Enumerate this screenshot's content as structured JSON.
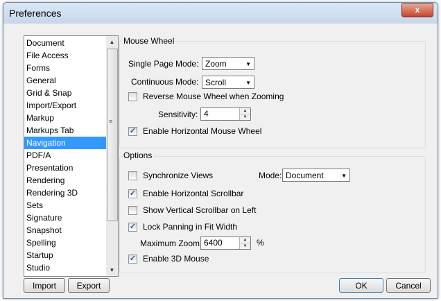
{
  "window": {
    "title": "Preferences",
    "close_glyph": "x"
  },
  "categories": {
    "items": [
      "Document",
      "File Access",
      "Forms",
      "General",
      "Grid & Snap",
      "Import/Export",
      "Markup",
      "Markups Tab",
      "Navigation",
      "PDF/A",
      "Presentation",
      "Rendering",
      "Rendering 3D",
      "Sets",
      "Signature",
      "Snapshot",
      "Spelling",
      "Startup",
      "Studio"
    ],
    "selected": "Navigation"
  },
  "mouse_wheel": {
    "group_label": "Mouse Wheel",
    "single_page_label": "Single Page Mode:",
    "single_page_value": "Zoom",
    "continuous_label": "Continuous Mode:",
    "continuous_value": "Scroll",
    "reverse_label": "Reverse Mouse Wheel when Zooming",
    "reverse_checked": false,
    "sensitivity_label": "Sensitivity:",
    "sensitivity_value": "4",
    "horizontal_label": "Enable Horizontal Mouse Wheel",
    "horizontal_checked": true
  },
  "options": {
    "group_label": "Options",
    "sync_label": "Synchronize Views",
    "sync_checked": false,
    "mode_label": "Mode:",
    "mode_value": "Document",
    "hscroll_label": "Enable Horizontal Scrollbar",
    "hscroll_checked": true,
    "vscroll_left_label": "Show Vertical Scrollbar on Left",
    "vscroll_left_checked": false,
    "lock_pan_label": "Lock Panning in Fit Width",
    "lock_pan_checked": true,
    "max_zoom_label": "Maximum Zoom:",
    "max_zoom_value": "6400",
    "max_zoom_unit": "%",
    "mouse3d_label": "Enable 3D Mouse",
    "mouse3d_checked": true
  },
  "buttons": {
    "import": "Import",
    "export": "Export",
    "ok": "OK",
    "cancel": "Cancel"
  },
  "colors": {
    "selection": "#3399ff",
    "title_gradient_top": "#dbe7f4",
    "close_red": "#c7442b"
  },
  "icons": {
    "close": "close-icon",
    "scroll_up": "arrow-up-icon",
    "scroll_down": "arrow-down-icon",
    "combo": "chevron-down-icon"
  }
}
